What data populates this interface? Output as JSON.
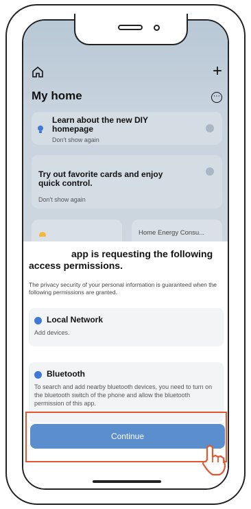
{
  "header": {
    "title": "My home",
    "home_icon": "home-icon",
    "add_icon": "plus-icon",
    "more_icon": "more-icon"
  },
  "cards": {
    "diy": {
      "title": "Learn about the new DIY homepage",
      "subtitle": "Don't show again"
    },
    "favorites": {
      "title": "Try out favorite cards and enjoy quick control.",
      "subtitle": "Don't show again"
    },
    "energy_label": "Home Energy Consu..."
  },
  "sheet": {
    "title_suffix": "app is requesting the following access permissions.",
    "description": "The privacy security of your personal information is guaranteed when the following permissions are granted.",
    "permissions": [
      {
        "name": "Local Network",
        "description": "Add devices.",
        "icon": "network-icon"
      },
      {
        "name": "Bluetooth",
        "description": "To search and add nearby bluetooth devices, you need to turn on the bluetooth switch of the phone and allow the bluetooth permission of this app.",
        "icon": "bluetooth-icon"
      }
    ],
    "continue_label": "Continue"
  },
  "colors": {
    "accent": "#5b8ecd",
    "highlight": "#e4572e",
    "permission_icon": "#3e7ad4"
  }
}
